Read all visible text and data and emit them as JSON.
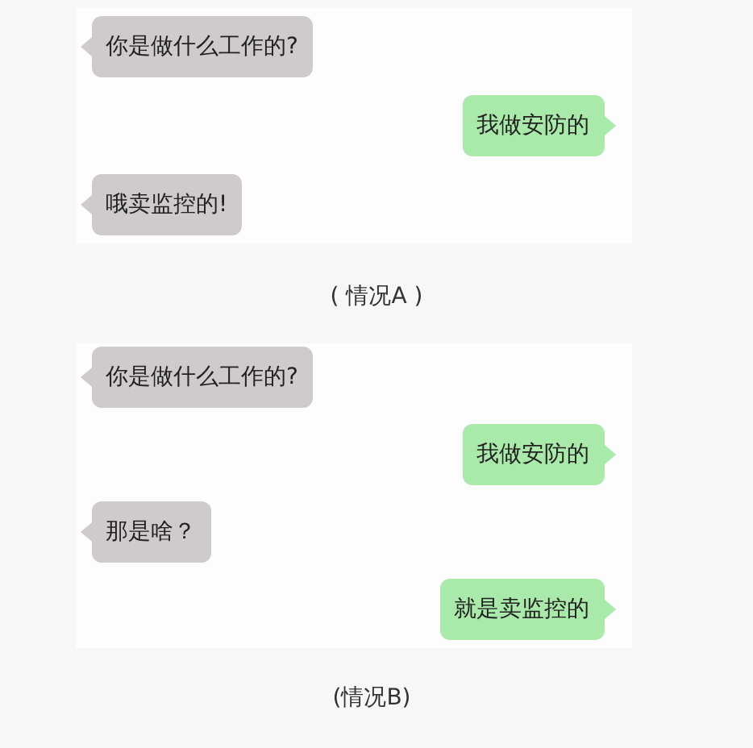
{
  "panels": [
    {
      "messages": [
        {
          "kind": "incoming",
          "text": "你是做什么工作的?"
        },
        {
          "kind": "outgoing",
          "text": "我做安防的"
        },
        {
          "kind": "incoming",
          "text": "哦卖监控的!"
        }
      ],
      "caption": "( 情况A )"
    },
    {
      "messages": [
        {
          "kind": "incoming",
          "text": "你是做什么工作的?"
        },
        {
          "kind": "outgoing",
          "text": "我做安防的"
        },
        {
          "kind": "incoming",
          "text": "那是啥？"
        },
        {
          "kind": "outgoing",
          "text": "就是卖监控的"
        }
      ],
      "caption": "(情况B)"
    }
  ]
}
